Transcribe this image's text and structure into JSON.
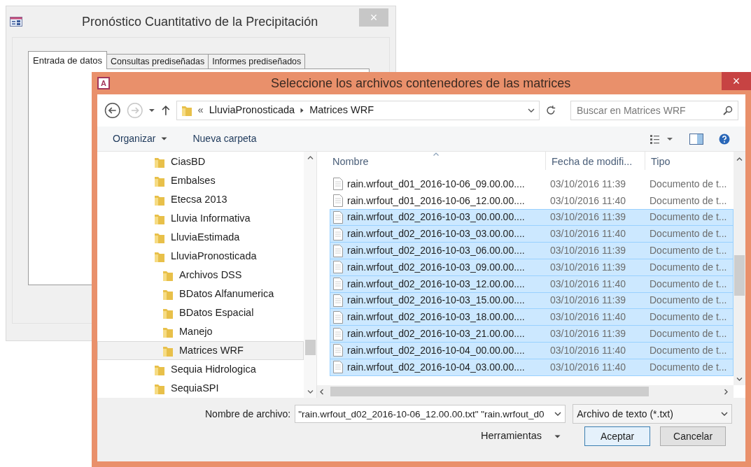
{
  "back_window": {
    "title": "Pronóstico Cuantitativo de la Precipitación",
    "close": "×",
    "tabs": [
      {
        "label": "Entrada de datos",
        "selected": true
      },
      {
        "label": "Consultas prediseñadas",
        "selected": false
      },
      {
        "label": "Informes prediseñados",
        "selected": false
      }
    ]
  },
  "dialog": {
    "icon_letter": "A",
    "title": "Seleccione los archivos contenedores de las matrices",
    "close": "×",
    "address": {
      "prefix": "«",
      "segments": [
        "LluviaPronosticada",
        "Matrices WRF"
      ]
    },
    "search": {
      "placeholder": "Buscar en Matrices WRF"
    },
    "commands": [
      {
        "label": "Organizar",
        "dropdown": true
      },
      {
        "label": "Nueva carpeta",
        "dropdown": false
      }
    ],
    "nav_tree": [
      {
        "label": "CiasBD",
        "selected": false
      },
      {
        "label": "Embalses",
        "selected": false
      },
      {
        "label": "Etecsa 2013",
        "selected": false
      },
      {
        "label": "Lluvia Informativa",
        "selected": false
      },
      {
        "label": "LluviaEstimada",
        "selected": false
      },
      {
        "label": "LluviaPronosticada",
        "selected": false,
        "children": [
          {
            "label": "Archivos DSS",
            "selected": false
          },
          {
            "label": "BDatos Alfanumerica",
            "selected": false
          },
          {
            "label": "BDatos Espacial",
            "selected": false
          },
          {
            "label": "Manejo",
            "selected": false
          },
          {
            "label": "Matrices WRF",
            "selected": true
          }
        ]
      },
      {
        "label": "Sequia Hidrologica",
        "selected": false
      },
      {
        "label": "SequiaSPI",
        "selected": false
      }
    ],
    "columns": [
      "Nombre",
      "Fecha de modifi...",
      "Tipo"
    ],
    "files": [
      {
        "name": "rain.wrfout_d01_2016-10-06_09.00.00....",
        "date": "03/10/2016 11:39",
        "type": "Documento de t...",
        "selected": false
      },
      {
        "name": "rain.wrfout_d01_2016-10-06_12.00.00....",
        "date": "03/10/2016 11:40",
        "type": "Documento de t...",
        "selected": false
      },
      {
        "name": "rain.wrfout_d02_2016-10-03_00.00.00....",
        "date": "03/10/2016 11:39",
        "type": "Documento de t...",
        "selected": true
      },
      {
        "name": "rain.wrfout_d02_2016-10-03_03.00.00....",
        "date": "03/10/2016 11:40",
        "type": "Documento de t...",
        "selected": true
      },
      {
        "name": "rain.wrfout_d02_2016-10-03_06.00.00....",
        "date": "03/10/2016 11:39",
        "type": "Documento de t...",
        "selected": true
      },
      {
        "name": "rain.wrfout_d02_2016-10-03_09.00.00....",
        "date": "03/10/2016 11:39",
        "type": "Documento de t...",
        "selected": true
      },
      {
        "name": "rain.wrfout_d02_2016-10-03_12.00.00....",
        "date": "03/10/2016 11:40",
        "type": "Documento de t...",
        "selected": true
      },
      {
        "name": "rain.wrfout_d02_2016-10-03_15.00.00....",
        "date": "03/10/2016 11:39",
        "type": "Documento de t...",
        "selected": true
      },
      {
        "name": "rain.wrfout_d02_2016-10-03_18.00.00....",
        "date": "03/10/2016 11:40",
        "type": "Documento de t...",
        "selected": true
      },
      {
        "name": "rain.wrfout_d02_2016-10-03_21.00.00....",
        "date": "03/10/2016 11:39",
        "type": "Documento de t...",
        "selected": true
      },
      {
        "name": "rain.wrfout_d02_2016-10-04_00.00.00....",
        "date": "03/10/2016 11:40",
        "type": "Documento de t...",
        "selected": true
      },
      {
        "name": "rain.wrfout_d02_2016-10-04_03.00.00....",
        "date": "03/10/2016 11:40",
        "type": "Documento de t...",
        "selected": true
      }
    ],
    "filename": {
      "label": "Nombre de archivo:",
      "value": "\"rain.wrfout_d02_2016-10-06_12.00.00.txt\" \"rain.wrfout_d0"
    },
    "filetype": "Archivo de texto (*.txt)",
    "tools": "Herramientas",
    "buttons": [
      "Aceptar",
      "Cancelar"
    ]
  }
}
